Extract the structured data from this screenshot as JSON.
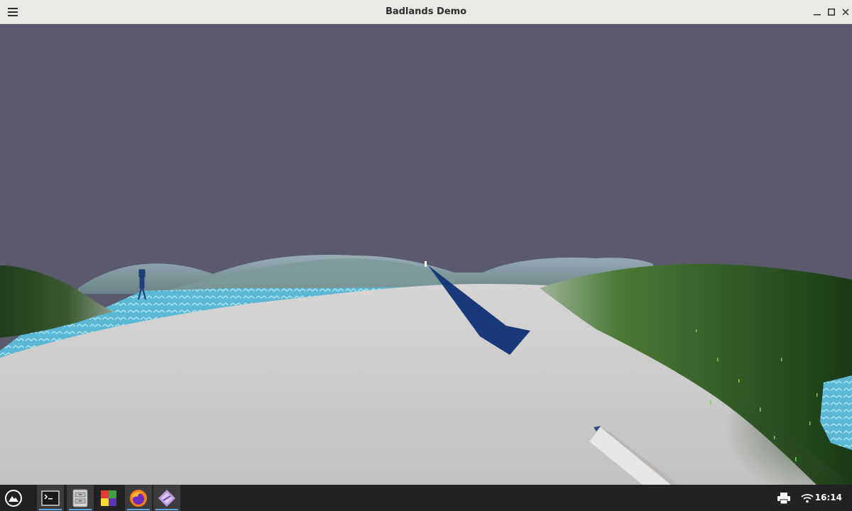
{
  "window": {
    "title": "Badlands Demo",
    "menu_icon": "hamburger-menu-icon",
    "controls": [
      "minimize-icon",
      "maximize-icon",
      "close-icon"
    ]
  },
  "scene": {
    "sky_color": "#5a5a6c",
    "snow_color": "#c6c5c4",
    "water_color": "#6cc4dc",
    "grass_color": "#3b6a2c",
    "distant_hill_color": "#6f8f95",
    "flag_color": "#18397a",
    "figure_color": "#1f3f78",
    "held_item_color": "#e8e6e4"
  },
  "taskbar": {
    "items": [
      {
        "name": "app-launcher-icon",
        "active": false
      },
      {
        "name": "terminal-icon",
        "active": true
      },
      {
        "name": "file-manager-icon",
        "active": true
      },
      {
        "name": "colorful-app-icon",
        "active": false
      },
      {
        "name": "firefox-icon",
        "active": true
      },
      {
        "name": "game-app-icon",
        "active": true
      }
    ],
    "tray": [
      "printer-icon",
      "wifi-icon"
    ],
    "clock": "16:14"
  }
}
